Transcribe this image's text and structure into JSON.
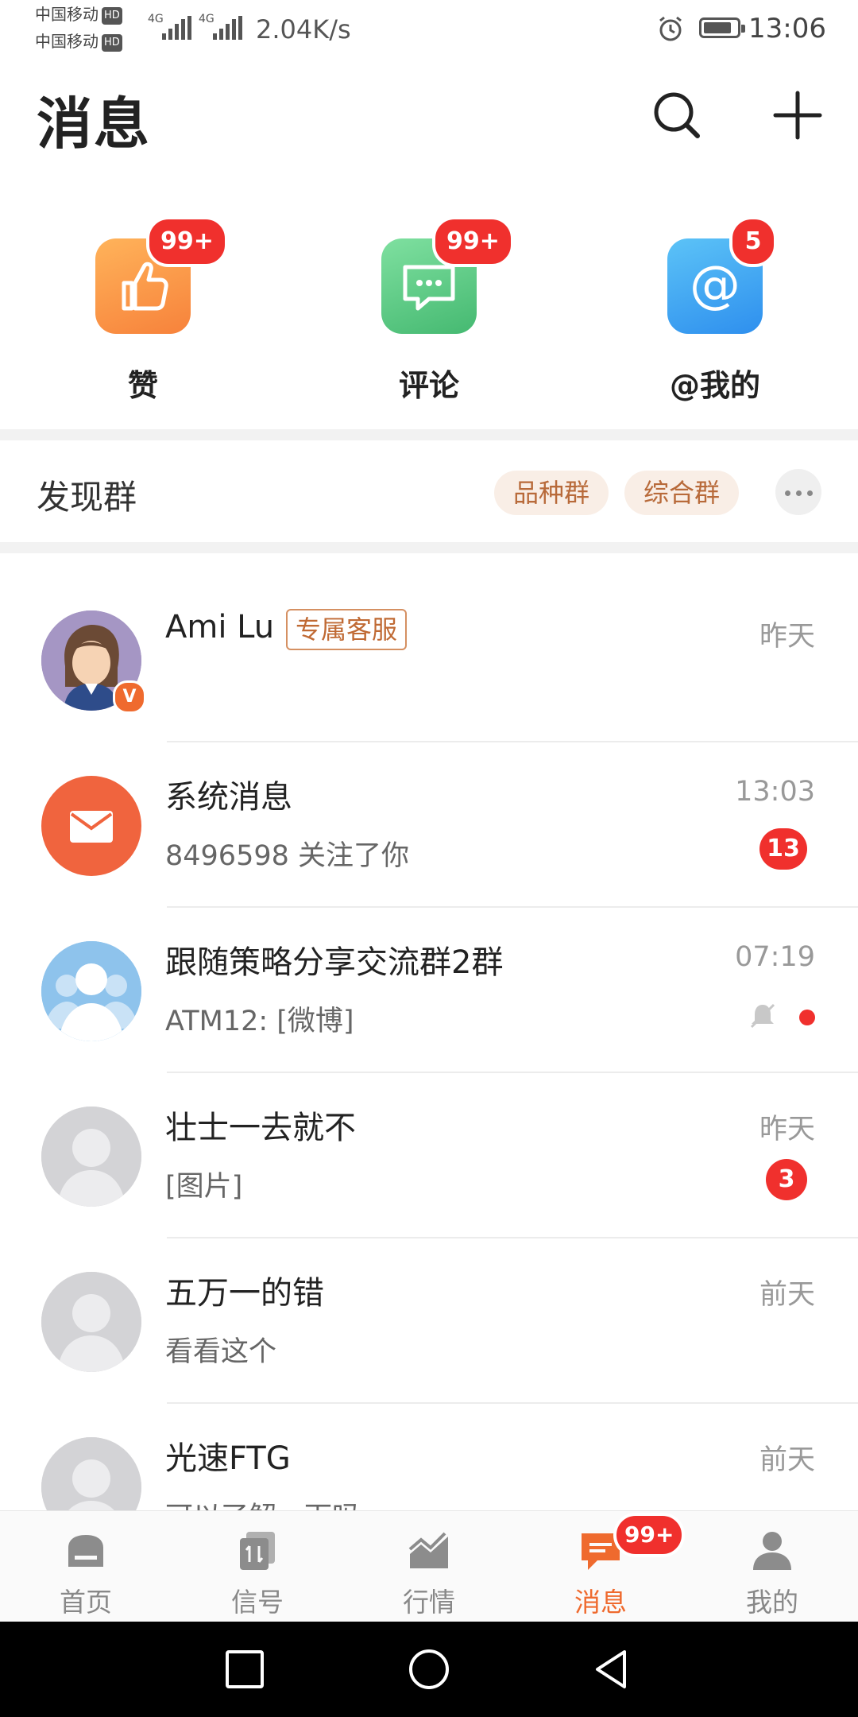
{
  "status_bar": {
    "carrier1": "中国移动",
    "carrier2": "中国移动",
    "hd": "HD",
    "net1": "4G",
    "net2": "4G",
    "speed": "2.04K/s",
    "time": "13:06"
  },
  "header": {
    "title": "消息",
    "search_icon": "search-icon",
    "add_icon": "plus-icon"
  },
  "quick_actions": [
    {
      "label": "赞",
      "badge": "99+",
      "icon": "thumbs-up-icon",
      "color": "#f98c3b"
    },
    {
      "label": "评论",
      "badge": "99+",
      "icon": "comment-icon",
      "color": "#52c27d"
    },
    {
      "label": "@我的",
      "badge": "5",
      "icon": "at-icon",
      "color": "#3ea2f1"
    }
  ],
  "discover": {
    "title": "发现群",
    "chips": [
      "品种群",
      "综合群"
    ]
  },
  "conversations": [
    {
      "name": "Ami Lu",
      "tag": "专属客服",
      "time": "昨天",
      "preview": "",
      "badge": ""
    },
    {
      "name": "系统消息",
      "time": "13:03",
      "preview": "8496598 关注了你",
      "badge": "13"
    },
    {
      "name": "跟随策略分享交流群2群",
      "time": "07:19",
      "preview": "ATM12: [微博]",
      "badge": ""
    },
    {
      "name": "壮士一去就不",
      "time": "昨天",
      "preview": "[图片]",
      "badge": "3"
    },
    {
      "name": "五万一的错",
      "time": "前天",
      "preview": "看看这个",
      "badge": ""
    },
    {
      "name": "光速FTG",
      "time": "前天",
      "preview": "可以了解一下吗",
      "badge": ""
    }
  ],
  "bottom_nav": {
    "items": [
      {
        "label": "首页",
        "icon": "home-icon"
      },
      {
        "label": "信号",
        "icon": "signal-icon"
      },
      {
        "label": "行情",
        "icon": "market-chart-icon"
      },
      {
        "label": "消息",
        "icon": "message-icon",
        "badge": "99+"
      },
      {
        "label": "我的",
        "icon": "profile-icon"
      }
    ],
    "active_index": 3
  },
  "colors": {
    "accent": "#ef6a2e",
    "badge": "#f0302d"
  }
}
